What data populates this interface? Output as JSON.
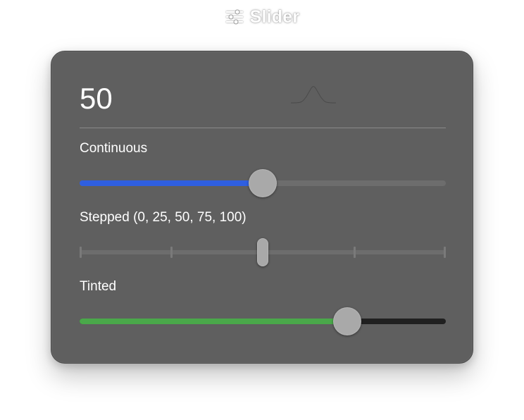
{
  "header": {
    "title": "Slider",
    "icon": "sliders-icon"
  },
  "popover": {
    "value_display": "50"
  },
  "sliders": {
    "continuous": {
      "label": "Continuous",
      "value": 50,
      "min": 0,
      "max": 100,
      "fill_color": "#2f5fe0"
    },
    "stepped": {
      "label": "Stepped (0, 25, 50, 75, 100)",
      "value": 50,
      "min": 0,
      "max": 100,
      "steps": [
        0,
        25,
        50,
        75,
        100
      ]
    },
    "tinted": {
      "label": "Tinted",
      "value": 73,
      "min": 0,
      "max": 100,
      "fill_color": "#4aa84a",
      "track_color": "#202020"
    }
  }
}
